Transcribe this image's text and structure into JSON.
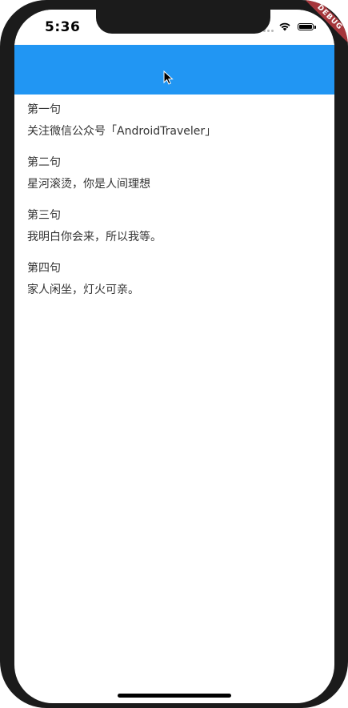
{
  "status_bar": {
    "time": "5:36",
    "debug_label": "DEBUG"
  },
  "colors": {
    "app_bar": "#2196f3",
    "debug_banner": "#a5363b"
  },
  "verses": [
    {
      "title": "第一句",
      "text": "关注微信公众号「AndroidTraveler」"
    },
    {
      "title": "第二句",
      "text": "星河滚烫，你是人间理想"
    },
    {
      "title": "第三句",
      "text": "我明白你会来，所以我等。"
    },
    {
      "title": "第四句",
      "text": "家人闲坐，灯火可亲。"
    }
  ]
}
